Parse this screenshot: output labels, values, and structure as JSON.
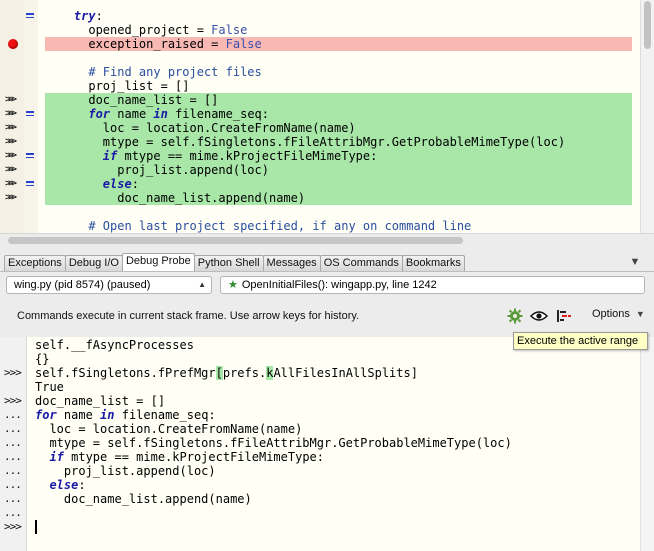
{
  "editor": {
    "lines": [
      {
        "gutter": "",
        "fold": true,
        "bp": false,
        "hl": "",
        "parts": [
          {
            "t": "    "
          },
          {
            "t": "try",
            "c": "kw"
          },
          {
            "t": ":"
          }
        ]
      },
      {
        "gutter": "",
        "fold": false,
        "bp": false,
        "hl": "",
        "parts": [
          {
            "t": "      opened_project = "
          },
          {
            "t": "False",
            "c": "kc"
          }
        ]
      },
      {
        "gutter": "",
        "fold": false,
        "bp": true,
        "hl": "red",
        "parts": [
          {
            "t": "      exception_raised = "
          },
          {
            "t": "False",
            "c": "kc"
          }
        ]
      },
      {
        "gutter": "",
        "fold": false,
        "bp": false,
        "hl": "",
        "parts": [
          {
            "t": ""
          }
        ]
      },
      {
        "gutter": "",
        "fold": false,
        "bp": false,
        "hl": "",
        "parts": [
          {
            "t": "      "
          },
          {
            "t": "# Find any project files",
            "c": "cm"
          }
        ]
      },
      {
        "gutter": "",
        "fold": false,
        "bp": false,
        "hl": "",
        "parts": [
          {
            "t": "      proj_list = []"
          }
        ]
      },
      {
        "gutter": ">>>",
        "fold": false,
        "bp": false,
        "hl": "green",
        "parts": [
          {
            "t": "      doc_name_list = []"
          }
        ]
      },
      {
        "gutter": ">>>",
        "fold": true,
        "bp": false,
        "hl": "green",
        "parts": [
          {
            "t": "      "
          },
          {
            "t": "for",
            "c": "kw"
          },
          {
            "t": " name "
          },
          {
            "t": "in",
            "c": "kw"
          },
          {
            "t": " filename_seq:"
          }
        ]
      },
      {
        "gutter": ">>>",
        "fold": false,
        "bp": false,
        "hl": "green",
        "parts": [
          {
            "t": "        loc = location.CreateFromName(name)"
          }
        ]
      },
      {
        "gutter": ">>>",
        "fold": false,
        "bp": false,
        "hl": "green",
        "parts": [
          {
            "t": "        mtype = self.fSingletons.fFileAttribMgr.GetProbableMimeType(loc)"
          }
        ]
      },
      {
        "gutter": ">>>",
        "fold": true,
        "bp": false,
        "hl": "green",
        "parts": [
          {
            "t": "        "
          },
          {
            "t": "if",
            "c": "kw"
          },
          {
            "t": " mtype == mime.kProjectFileMimeType:"
          }
        ]
      },
      {
        "gutter": ">>>",
        "fold": false,
        "bp": false,
        "hl": "green",
        "parts": [
          {
            "t": "          proj_list.append(loc)"
          }
        ]
      },
      {
        "gutter": ">>>",
        "fold": true,
        "bp": false,
        "hl": "green",
        "parts": [
          {
            "t": "        "
          },
          {
            "t": "else",
            "c": "kw"
          },
          {
            "t": ":"
          }
        ]
      },
      {
        "gutter": ">>>",
        "fold": false,
        "bp": false,
        "hl": "green",
        "parts": [
          {
            "t": "          doc_name_list.append(name)"
          }
        ]
      },
      {
        "gutter": "",
        "fold": false,
        "bp": false,
        "hl": "",
        "parts": [
          {
            "t": ""
          }
        ]
      },
      {
        "gutter": "",
        "fold": false,
        "bp": false,
        "hl": "",
        "parts": [
          {
            "t": "      "
          },
          {
            "t": "# Open last project specified, if any on command line",
            "c": "cm"
          }
        ]
      }
    ]
  },
  "tabs": [
    {
      "label": "Exceptions",
      "active": false
    },
    {
      "label": "Debug I/O",
      "active": false
    },
    {
      "label": "Debug Probe",
      "active": true
    },
    {
      "label": "Python Shell",
      "active": false
    },
    {
      "label": "Messages",
      "active": false
    },
    {
      "label": "OS Commands",
      "active": false
    },
    {
      "label": "Bookmarks",
      "active": false
    }
  ],
  "tab_menu_glyph": "▼",
  "probe": {
    "process": "wing.py (pid 8574) (paused)",
    "frame": "OpenInitialFiles(): wingapp.py, line 1242",
    "frame_star": "★",
    "hint": "Commands execute in current stack frame.  Use arrow keys for history.",
    "options_label": "Options",
    "tooltip": "Execute the active range",
    "icons": {
      "gear": "gear-icon",
      "eye": "eye-icon",
      "range": "active-range-icon"
    }
  },
  "console": {
    "lines": [
      {
        "prompt": "",
        "parts": [
          {
            "t": "self.__fAsyncProcesses"
          }
        ]
      },
      {
        "prompt": "",
        "parts": [
          {
            "t": "{}"
          }
        ]
      },
      {
        "prompt": ">>>",
        "parts": [
          {
            "t": "self.fSingletons.fPrefMgr"
          },
          {
            "t": "[",
            "c": "brk-open"
          },
          {
            "t": "prefs."
          },
          {
            "t": "k",
            "c": "brk-k"
          },
          {
            "t": "AllFilesInAllSplits]"
          }
        ]
      },
      {
        "prompt": "",
        "parts": [
          {
            "t": "True"
          }
        ]
      },
      {
        "prompt": ">>>",
        "parts": [
          {
            "t": "doc_name_list = []"
          }
        ]
      },
      {
        "prompt": "...",
        "parts": [
          {
            "t": "for",
            "c": "kw"
          },
          {
            "t": " name "
          },
          {
            "t": "in",
            "c": "kw"
          },
          {
            "t": " filename_seq:"
          }
        ]
      },
      {
        "prompt": "...",
        "parts": [
          {
            "t": "  loc = location.CreateFromName(name)"
          }
        ]
      },
      {
        "prompt": "...",
        "parts": [
          {
            "t": "  mtype = self.fSingletons.fFileAttribMgr.GetProbableMimeType(loc)"
          }
        ]
      },
      {
        "prompt": "...",
        "parts": [
          {
            "t": "  "
          },
          {
            "t": "if",
            "c": "kw"
          },
          {
            "t": " mtype == mime.kProjectFileMimeType:"
          }
        ]
      },
      {
        "prompt": "...",
        "parts": [
          {
            "t": "    proj_list.append(loc)"
          }
        ]
      },
      {
        "prompt": "...",
        "parts": [
          {
            "t": "  "
          },
          {
            "t": "else",
            "c": "kw"
          },
          {
            "t": ":"
          }
        ]
      },
      {
        "prompt": "...",
        "parts": [
          {
            "t": "    doc_name_list.append(name)"
          }
        ]
      },
      {
        "prompt": "...",
        "parts": [
          {
            "t": ""
          }
        ]
      },
      {
        "prompt": ">>>",
        "parts": [
          {
            "t": ""
          }
        ]
      }
    ]
  },
  "colors": {
    "editor_bg": "#fffff6",
    "breakpoint_line": "#f8b9b5",
    "active_range": "#a8e7a8",
    "keyword": "#1a1aa6",
    "comment": "#2a4ea0",
    "tooltip_bg": "#ffffc6"
  }
}
